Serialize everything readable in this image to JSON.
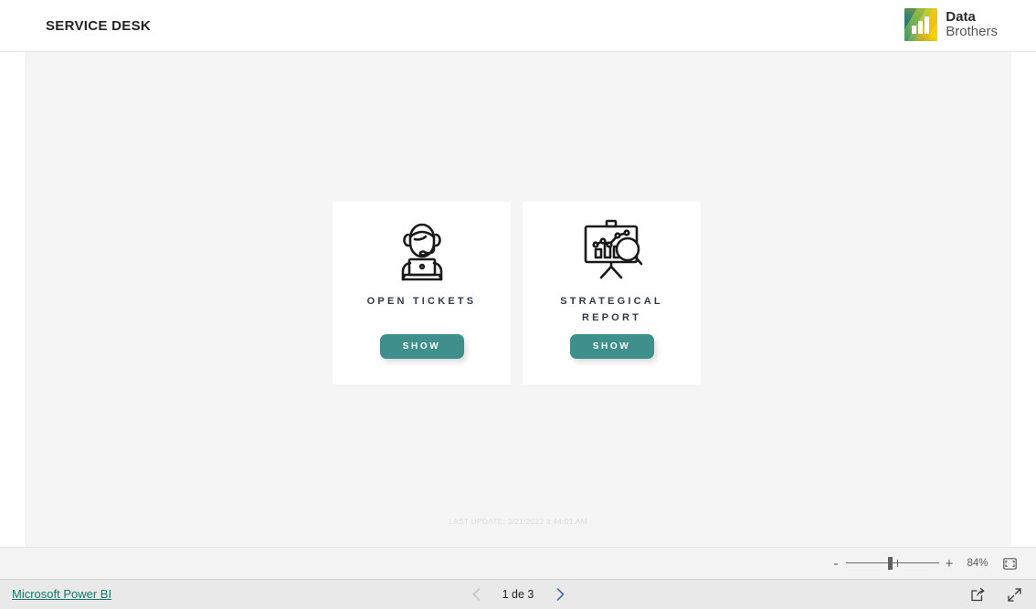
{
  "header": {
    "title": "SERVICE DESK",
    "brand": {
      "line1": "Data",
      "line2": "Brothers",
      "logo_icon": "bar-chart-logo-icon"
    }
  },
  "canvas": {
    "cards": [
      {
        "label": "OPEN TICKETS",
        "icon": "support-agent-headset-icon",
        "button_label": "SHOW"
      },
      {
        "label": "STRATEGICAL REPORT",
        "icon": "presentation-chart-magnifier-icon",
        "button_label": "SHOW"
      }
    ],
    "last_update": "LAST UPDATE: 3/21/2022 8:44:01 AM"
  },
  "zoombar": {
    "minus_label": "-",
    "plus_label": "+",
    "zoom_level": "84%",
    "fit_icon": "fit-to-page-icon"
  },
  "footer": {
    "powerbi_link": "Microsoft Power BI",
    "page_label": "1 de 3",
    "prev_icon": "chevron-left-icon",
    "next_icon": "chevron-right-icon",
    "share_icon": "share-icon",
    "fullscreen_icon": "fullscreen-expand-icon"
  },
  "colors": {
    "accent_teal": "#3f8f8c",
    "link_teal": "#11786b",
    "canvas_bg": "#f5f5f5",
    "footer_bg": "#e9e9e9"
  }
}
